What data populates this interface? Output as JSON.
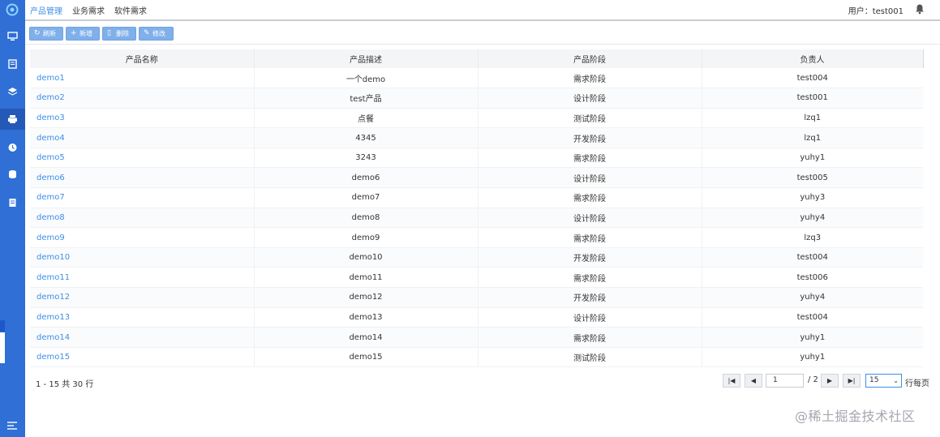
{
  "topbar": {
    "nav": [
      {
        "label": "产品管理",
        "active": true
      },
      {
        "label": "业务需求",
        "active": false
      },
      {
        "label": "软件需求",
        "active": false
      }
    ],
    "user_label": "用户：test001"
  },
  "sidebar": {
    "icons": [
      "logo-icon",
      "monitor-icon",
      "document-icon",
      "layers-icon",
      "printer-icon",
      "clock-icon",
      "database-icon",
      "report-icon",
      "menu-icon"
    ]
  },
  "toolbar": {
    "refresh": "刷新",
    "add": "新增",
    "delete": "删除",
    "edit": "修改"
  },
  "table": {
    "columns": [
      "产品名称",
      "产品描述",
      "产品阶段",
      "负责人"
    ],
    "rows": [
      [
        "demo1",
        "一个demo",
        "需求阶段",
        "test004"
      ],
      [
        "demo2",
        "test产品",
        "设计阶段",
        "test001"
      ],
      [
        "demo3",
        "点餐",
        "测试阶段",
        "lzq1"
      ],
      [
        "demo4",
        "4345",
        "开发阶段",
        "lzq1"
      ],
      [
        "demo5",
        "3243",
        "需求阶段",
        "yuhy1"
      ],
      [
        "demo6",
        "demo6",
        "设计阶段",
        "test005"
      ],
      [
        "demo7",
        "demo7",
        "需求阶段",
        "yuhy3"
      ],
      [
        "demo8",
        "demo8",
        "设计阶段",
        "yuhy4"
      ],
      [
        "demo9",
        "demo9",
        "需求阶段",
        "lzq3"
      ],
      [
        "demo10",
        "demo10",
        "开发阶段",
        "test004"
      ],
      [
        "demo11",
        "demo11",
        "需求阶段",
        "test006"
      ],
      [
        "demo12",
        "demo12",
        "开发阶段",
        "yuhy4"
      ],
      [
        "demo13",
        "demo13",
        "设计阶段",
        "test004"
      ],
      [
        "demo14",
        "demo14",
        "需求阶段",
        "yuhy1"
      ],
      [
        "demo15",
        "demo15",
        "测试阶段",
        "yuhy1"
      ]
    ]
  },
  "footer": {
    "summary": "1 - 15 共 30 行",
    "page_value": "1",
    "total_pages": "/ 2",
    "rows_per_page": "15",
    "rows_label": "行每页"
  },
  "watermark": "@稀土掘金技术社区",
  "colors": {
    "sidebar": "#2f6fd6",
    "accent": "#3d8ee9",
    "button": "#7fb0ea"
  }
}
